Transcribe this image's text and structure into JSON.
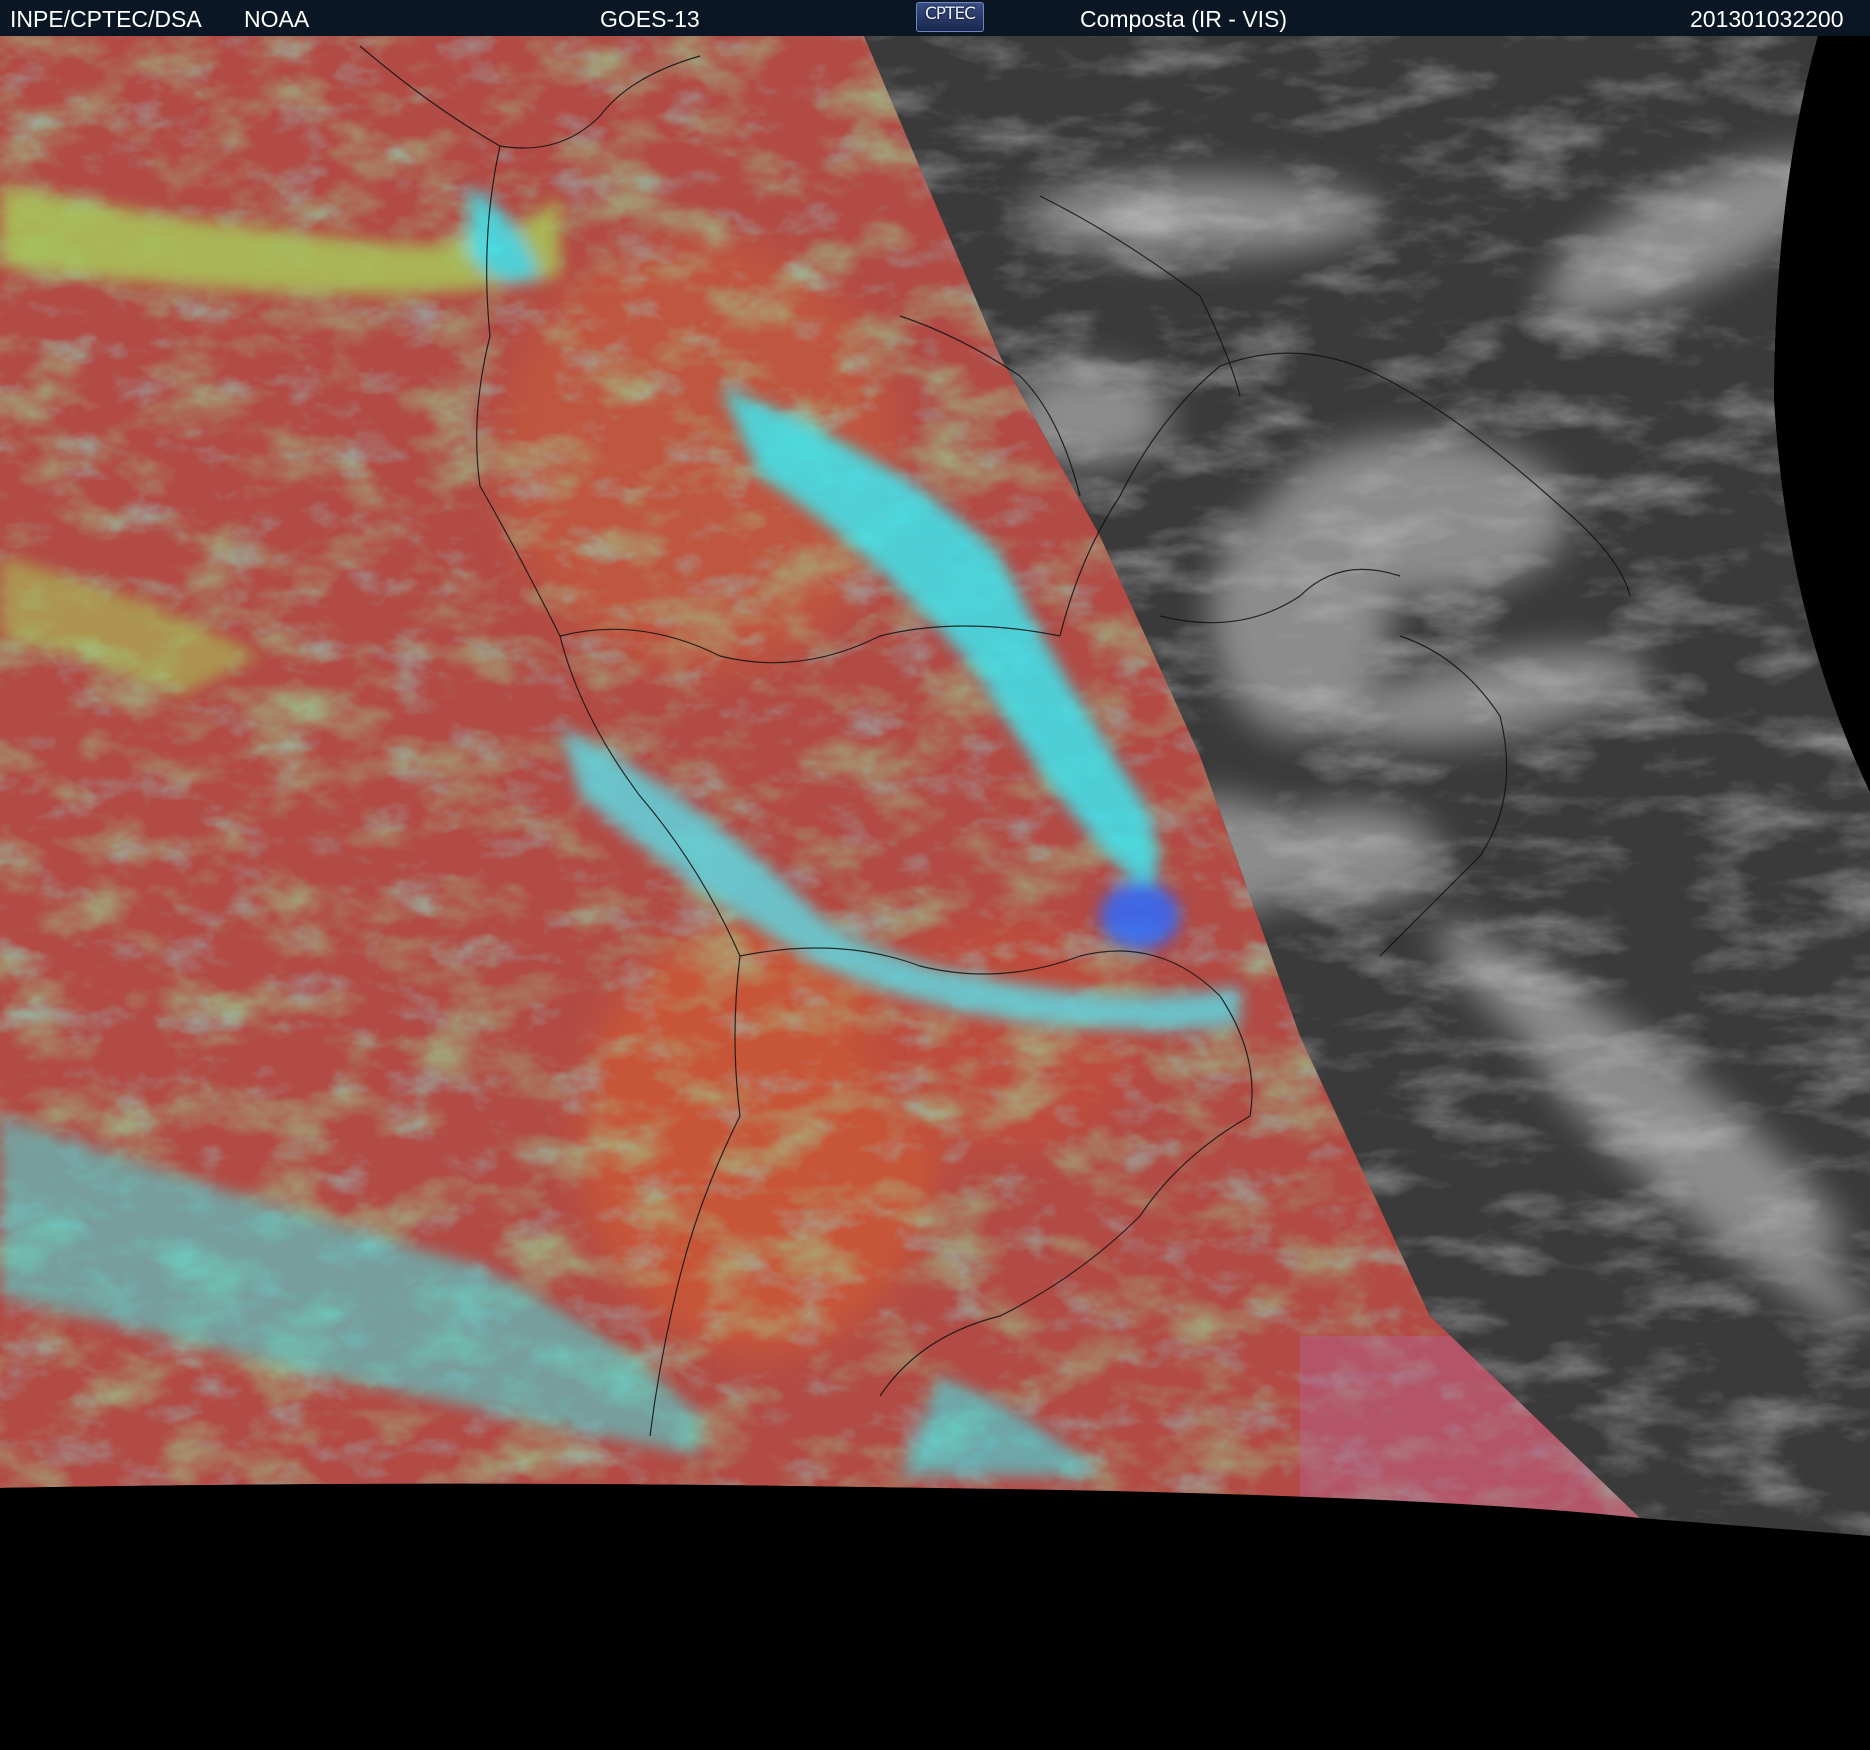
{
  "header": {
    "institution": "INPE/CPTEC/DSA",
    "agency": "NOAA",
    "satellite": "GOES-13",
    "logo": "CPTEC",
    "product": "Composta (IR - VIS)",
    "timestamp": "201301032200"
  },
  "colors": {
    "header_background": "#0b1624",
    "ir_ocean": "#b24b45",
    "ir_land_warm": "#cf5a36",
    "low_cloud": "#a8c85a",
    "high_cloud": "#3ee6f0",
    "deep_convection": "#2d6bff",
    "visible_side_base": "#3a3a3a",
    "visible_cloud": "#d8d8d8",
    "space": "#000000"
  }
}
